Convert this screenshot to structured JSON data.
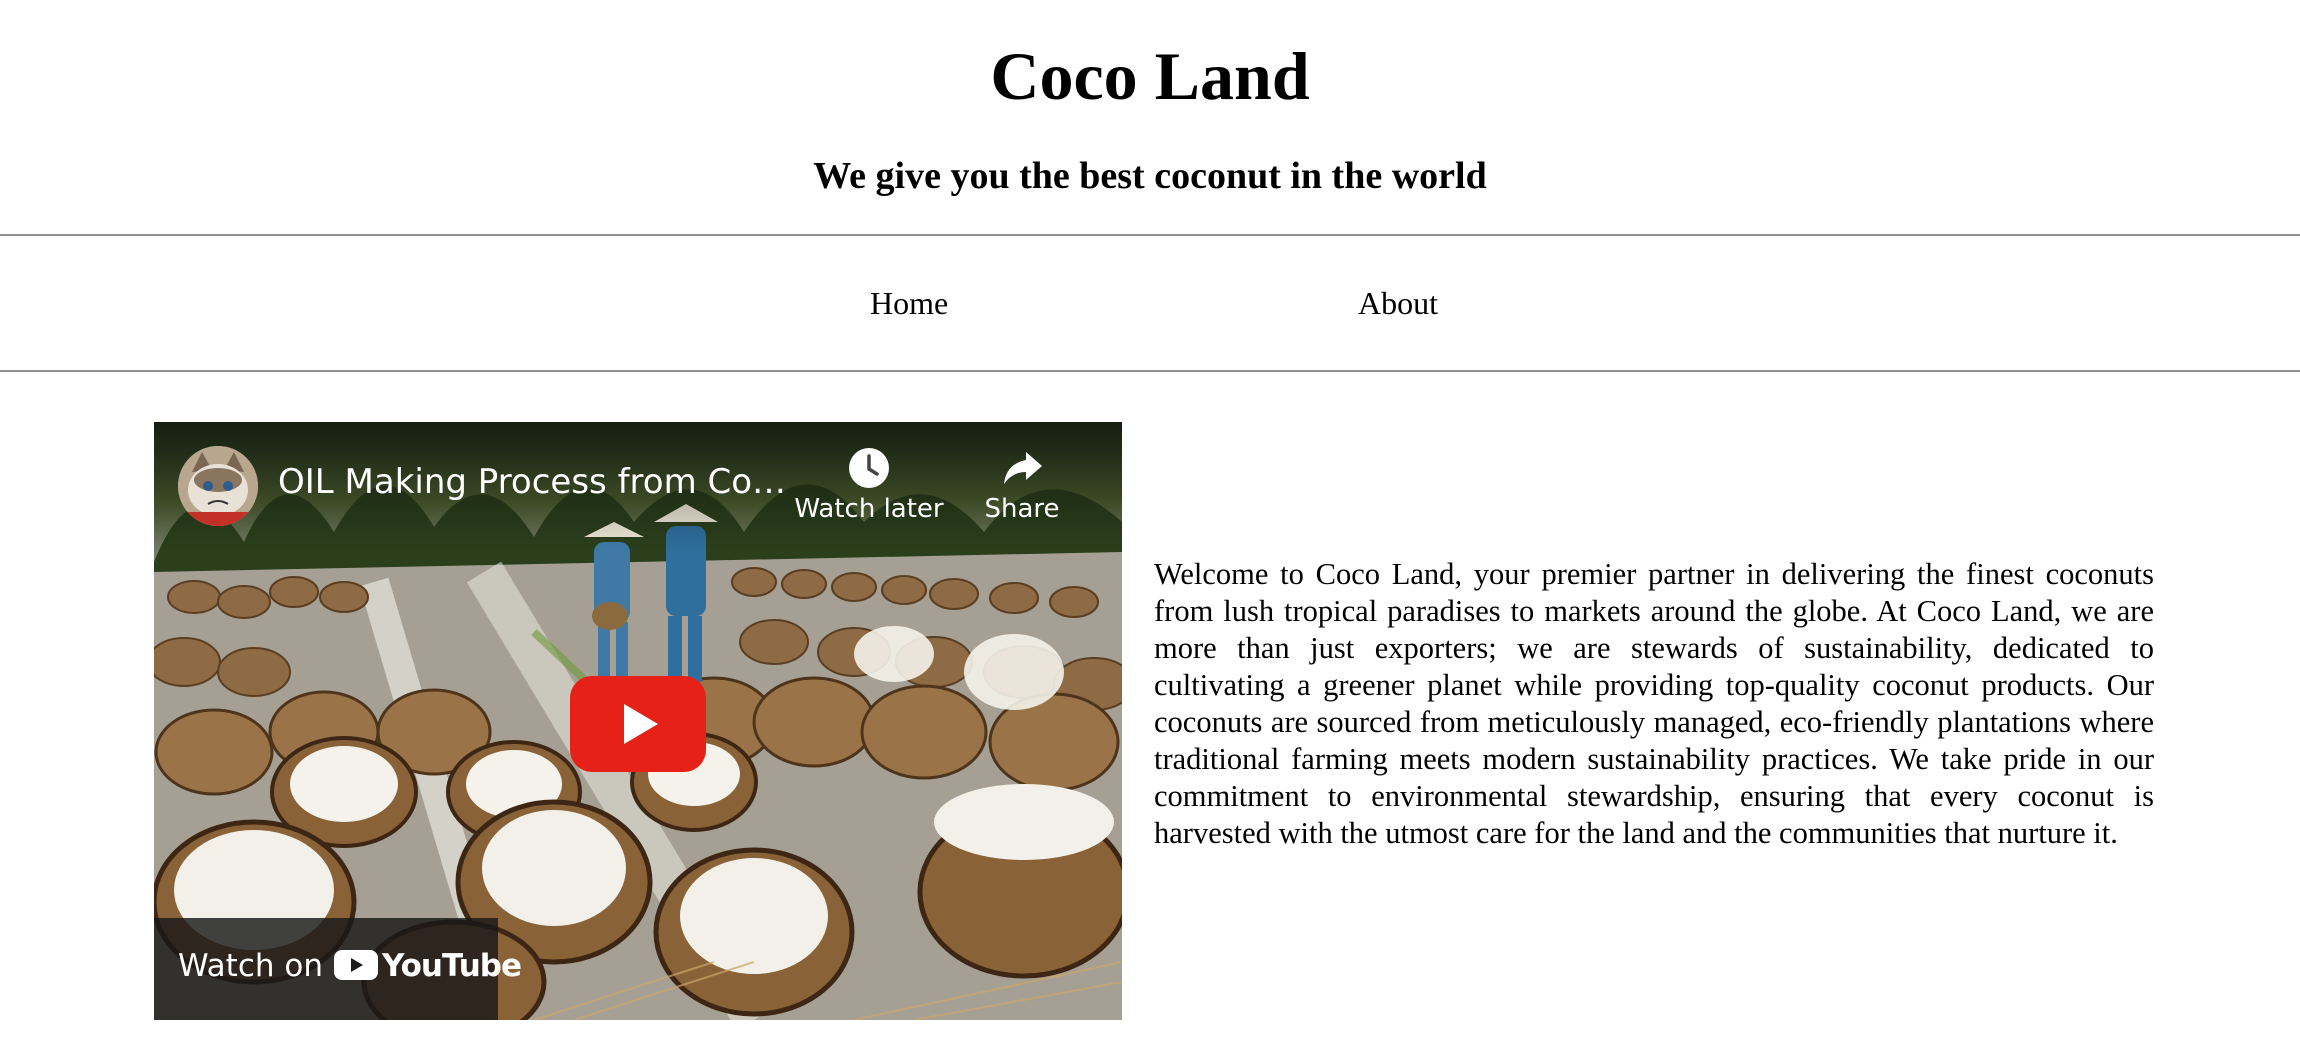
{
  "header": {
    "title": "Coco Land",
    "tagline": "We give you the best coconut in the world"
  },
  "nav": {
    "items": [
      {
        "label": "Home"
      },
      {
        "label": "About"
      }
    ]
  },
  "video": {
    "title": "OIL Making Process from Coc...",
    "watch_later_label": "Watch later",
    "share_label": "Share",
    "watch_on_label": "Watch on",
    "youtube_label": "YouTube",
    "icons": {
      "avatar": "cat-avatar",
      "watch_later": "clock-icon",
      "share": "share-arrow-icon",
      "play": "play-icon",
      "youtube": "youtube-logo"
    },
    "colors": {
      "play": "#e62117",
      "text": "#ffffff"
    }
  },
  "intro": {
    "text": "Welcome to Coco Land, your premier partner in delivering the finest coconuts from lush tropical paradises to markets around the globe. At Coco Land, we are more than just exporters; we are stewards of sustainability, dedicated to cultivating a greener planet while providing top-quality coconut products. Our coconuts are sourced from meticulously managed, eco-friendly plantations where traditional farming meets modern sustainability practices. We take pride in our commitment to environmental stewardship, ensuring that every coconut is harvested with the utmost care for the land and the communities that nurture it."
  }
}
